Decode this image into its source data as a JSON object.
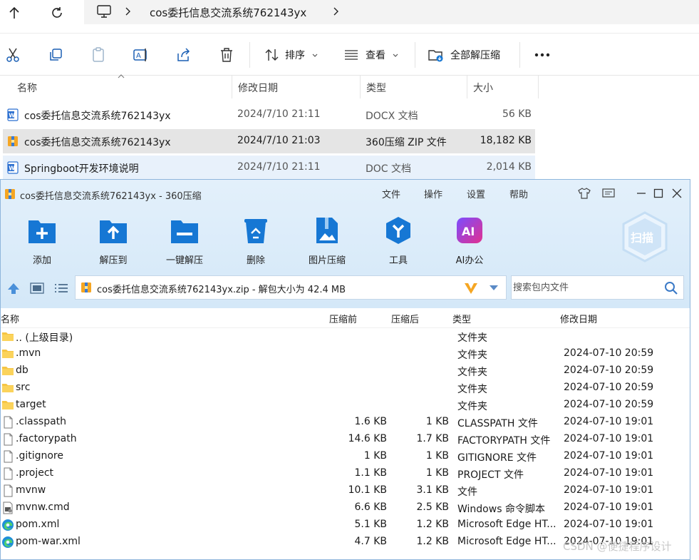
{
  "explorer": {
    "breadcrumb": "cos委托信息交流系统762143yx",
    "toolbar": {
      "sort_label": "排序",
      "view_label": "查看",
      "extract_all_label": "全部解压缩"
    },
    "columns": [
      "名称",
      "修改日期",
      "类型",
      "大小"
    ],
    "files": [
      {
        "name": "cos委托信息交流系统762143yx",
        "date": "2024/7/10 21:11",
        "type": "DOCX 文档",
        "size": "56 KB",
        "icon": "word-icon"
      },
      {
        "name": "cos委托信息交流系统762143yx",
        "date": "2024/7/10 21:03",
        "type": "360压缩 ZIP 文件",
        "size": "18,182 KB",
        "icon": "zip-icon"
      },
      {
        "name": "Springboot开发环境说明",
        "date": "2024/7/10 21:11",
        "type": "DOC 文档",
        "size": "2,014 KB",
        "icon": "word-icon"
      }
    ]
  },
  "archive": {
    "title": "cos委托信息交流系统762143yx - 360压缩",
    "menu": [
      "文件",
      "操作",
      "设置",
      "帮助"
    ],
    "tools": [
      "添加",
      "解压到",
      "一键解压",
      "删除",
      "图片压缩",
      "工具",
      "AI办公"
    ],
    "scan_label": "扫描",
    "path_text": "cos委托信息交流系统762143yx.zip - 解包大小为 42.4 MB",
    "search_placeholder": "搜索包内文件",
    "columns": {
      "name": "名称",
      "size": "压缩前",
      "packed": "压缩后",
      "type": "类型",
      "date": "修改日期"
    },
    "files": [
      {
        "name": ".. (上级目录)",
        "size": "",
        "packed": "",
        "type": "文件夹",
        "date": "",
        "icon": "folder-icon"
      },
      {
        "name": ".mvn",
        "size": "",
        "packed": "",
        "type": "文件夹",
        "date": "2024-07-10 20:59",
        "icon": "folder-icon"
      },
      {
        "name": "db",
        "size": "",
        "packed": "",
        "type": "文件夹",
        "date": "2024-07-10 20:59",
        "icon": "folder-icon"
      },
      {
        "name": "src",
        "size": "",
        "packed": "",
        "type": "文件夹",
        "date": "2024-07-10 20:59",
        "icon": "folder-icon"
      },
      {
        "name": "target",
        "size": "",
        "packed": "",
        "type": "文件夹",
        "date": "2024-07-10 20:59",
        "icon": "folder-icon"
      },
      {
        "name": ".classpath",
        "size": "1.6 KB",
        "packed": "1 KB",
        "type": "CLASSPATH 文件",
        "date": "2024-07-10 19:01",
        "icon": "file-icon"
      },
      {
        "name": ".factorypath",
        "size": "14.6 KB",
        "packed": "1.7 KB",
        "type": "FACTORYPATH 文件",
        "date": "2024-07-10 19:01",
        "icon": "file-icon"
      },
      {
        "name": ".gitignore",
        "size": "1 KB",
        "packed": "1 KB",
        "type": "GITIGNORE 文件",
        "date": "2024-07-10 19:01",
        "icon": "file-icon"
      },
      {
        "name": ".project",
        "size": "1.1 KB",
        "packed": "1 KB",
        "type": "PROJECT 文件",
        "date": "2024-07-10 19:01",
        "icon": "file-icon"
      },
      {
        "name": "mvnw",
        "size": "10.1 KB",
        "packed": "3.1 KB",
        "type": "文件",
        "date": "2024-07-10 19:01",
        "icon": "file-icon"
      },
      {
        "name": "mvnw.cmd",
        "size": "6.6 KB",
        "packed": "2.5 KB",
        "type": "Windows 命令脚本",
        "date": "2024-07-10 19:01",
        "icon": "cmd-file-icon"
      },
      {
        "name": "pom.xml",
        "size": "5.1 KB",
        "packed": "1.2 KB",
        "type": "Microsoft Edge HT...",
        "date": "2024-07-10 19:01",
        "icon": "edge-icon"
      },
      {
        "name": "pom-war.xml",
        "size": "4.7 KB",
        "packed": "1.2 KB",
        "type": "Microsoft Edge HT...",
        "date": "2024-07-10 19:01",
        "icon": "edge-icon"
      }
    ]
  },
  "watermark": "CSDN @便捷程序设计",
  "colors": {
    "accent": "#1677d4",
    "toolbar_bg": "#d9ebf9",
    "selected_row": "#e5e5e5",
    "hover_row": "#e8f1fb"
  }
}
